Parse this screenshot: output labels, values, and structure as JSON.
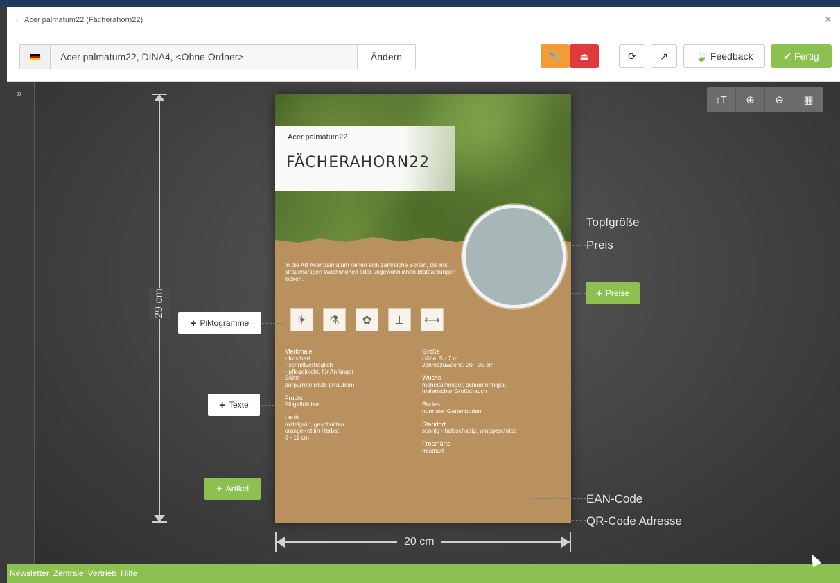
{
  "window": {
    "title": "Acer palmatum22 (Fächerahorn22)",
    "back_icon": "←",
    "close_icon": "×"
  },
  "toolbar": {
    "path_text": "Acer palmatum22, DINA4, <Ohne Ordner>",
    "change_label": "Ändern",
    "wrench_icon": "🔧",
    "stamp_icon": "⏏",
    "refresh_icon": "⟳",
    "external_icon": "↗",
    "feedback_label": "Feedback",
    "done_label": "Fertig"
  },
  "sidebar": {
    "toggle_icon": "»"
  },
  "zoom": {
    "text_icon": "↕T",
    "zoom_in_icon": "⊕",
    "zoom_out_icon": "⊖",
    "grid_icon": "▦"
  },
  "poster": {
    "latin_name": "Acer palmatum22",
    "common_name": "FÄCHERAHORN22",
    "intro": "In die Art Acer palmatum reihen sich zahlreiche Sorten, die mit strauchartigen Wuchshöhen oder ungewöhnlichen Blattfärbungen locken.",
    "pictograms": [
      "☀",
      "⚗",
      "✿",
      "⊥",
      "⟷"
    ],
    "left_col": [
      {
        "head": "Merkmale",
        "lines": [
          "• frosthart",
          "• schnittverträglich",
          "• pflegeleicht, für Anfänger"
        ]
      },
      {
        "head": "Blüte",
        "lines": [
          "purpurrote Blüte (Trauben)"
        ]
      },
      {
        "head": "Frucht",
        "lines": [
          "Flügelfrüchte"
        ]
      },
      {
        "head": "Laub",
        "lines": [
          "mittelgrün, geschnitten",
          "orange-rot im Herbst",
          "6 - 11 cm"
        ]
      }
    ],
    "right_col": [
      {
        "head": "Größe",
        "lines": [
          "Höhe: 5 - 7 m",
          "Jahreszuwachs: 20 - 35 cm"
        ]
      },
      {
        "head": "Wuchs",
        "lines": [
          "mehrstämmiger, schirmförmiger,",
          "malerischer Großstrauch"
        ]
      },
      {
        "head": "Boden",
        "lines": [
          "normaler Gartenboden"
        ]
      },
      {
        "head": "Standort",
        "lines": [
          "sonnig - halbschattig, windgeschützt"
        ]
      },
      {
        "head": "Frosthärte",
        "lines": [
          "frosthart"
        ]
      }
    ]
  },
  "dimensions": {
    "height_label": "29 cm",
    "width_label": "20 cm"
  },
  "callouts": {
    "topfgroesse": "Topfgröße",
    "preis": "Preis",
    "ean": "EAN-Code",
    "qr": "QR-Code Adresse"
  },
  "buttons": {
    "preise": "Preise",
    "piktogramme": "Piktogramme",
    "texte": "Texte",
    "artikel": "Artikel"
  },
  "footer": {
    "links": [
      "Newsletter",
      "Zentrale",
      "Vertrieb",
      "Hilfe"
    ]
  }
}
